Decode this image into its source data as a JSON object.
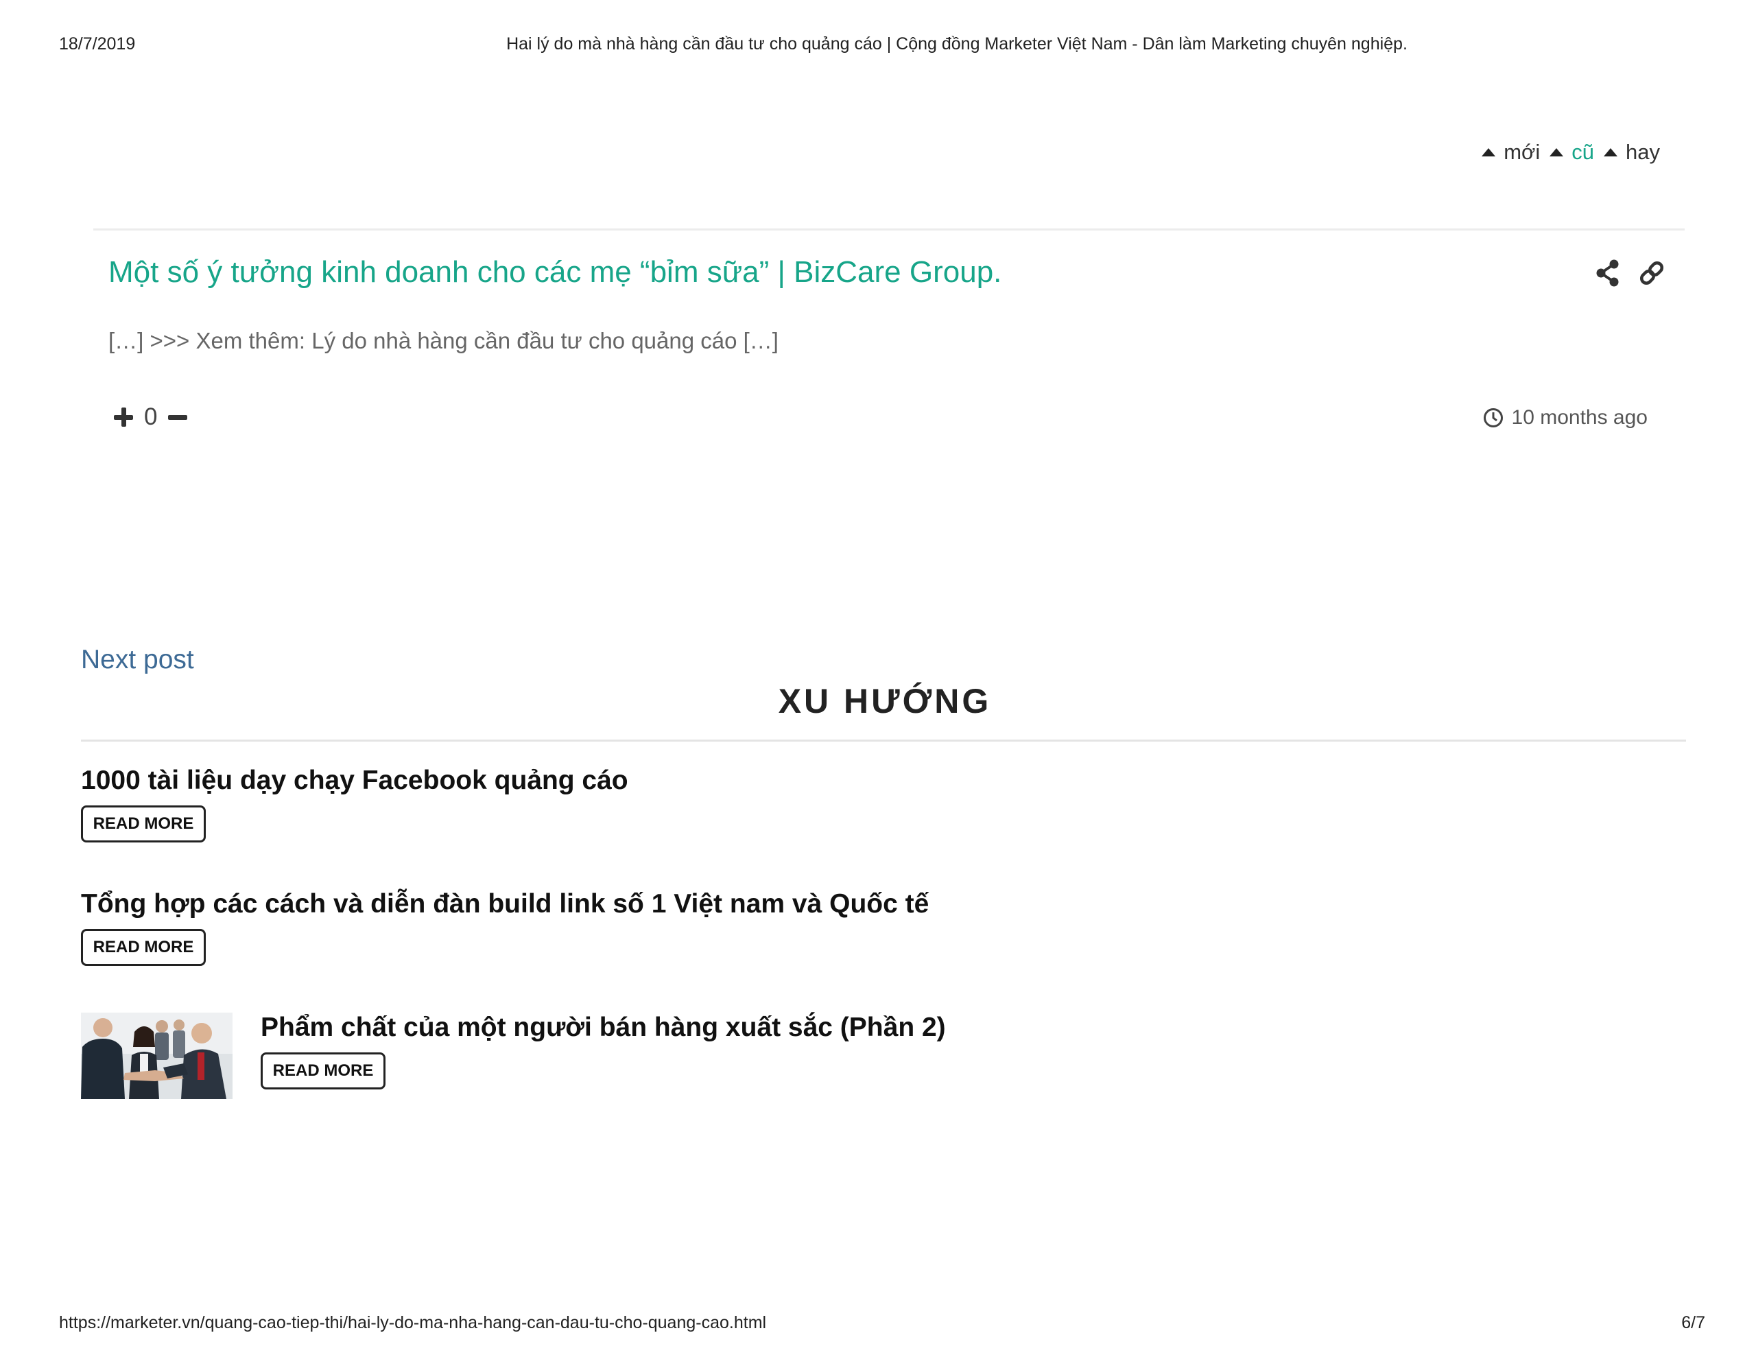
{
  "print_header": {
    "date": "18/7/2019",
    "title": "Hai lý do mà nhà hàng cần đầu tư cho quảng cáo | Cộng đồng Marketer Việt Nam - Dân làm Marketing chuyên nghiệp."
  },
  "sort": {
    "items": [
      {
        "label": "mới"
      },
      {
        "label": "cũ"
      },
      {
        "label": "hay"
      }
    ],
    "active_color": "#17a589"
  },
  "comment": {
    "title": "Một số ý tưởng kinh doanh cho các mẹ “bỉm sữa” | BizCare Group.",
    "excerpt": "[…] >>> Xem thêm: Lý do nhà hàng cần đầu tư cho quảng cáo […]",
    "votes": "0",
    "time": "10 months ago",
    "icons": [
      "share-icon",
      "link-icon",
      "clock-icon",
      "plus-icon",
      "minus-icon"
    ]
  },
  "nav": {
    "next_post": "Next post"
  },
  "trending": {
    "heading": "XU HƯỚNG",
    "items": [
      {
        "title": "1000 tài liệu dạy chạy Facebook quảng cáo",
        "button": "READ MORE"
      },
      {
        "title": "Tổng hợp các cách và diễn đàn build link số 1 Việt nam và Quốc tế",
        "button": "READ MORE"
      },
      {
        "title": "Phẩm chất của một người bán hàng xuất sắc (Phần 2)",
        "button": "READ MORE"
      }
    ]
  },
  "print_footer": {
    "url": "https://marketer.vn/quang-cao-tiep-thi/hai-ly-do-ma-nha-hang-can-dau-tu-cho-quang-cao.html",
    "page": "6/7"
  }
}
